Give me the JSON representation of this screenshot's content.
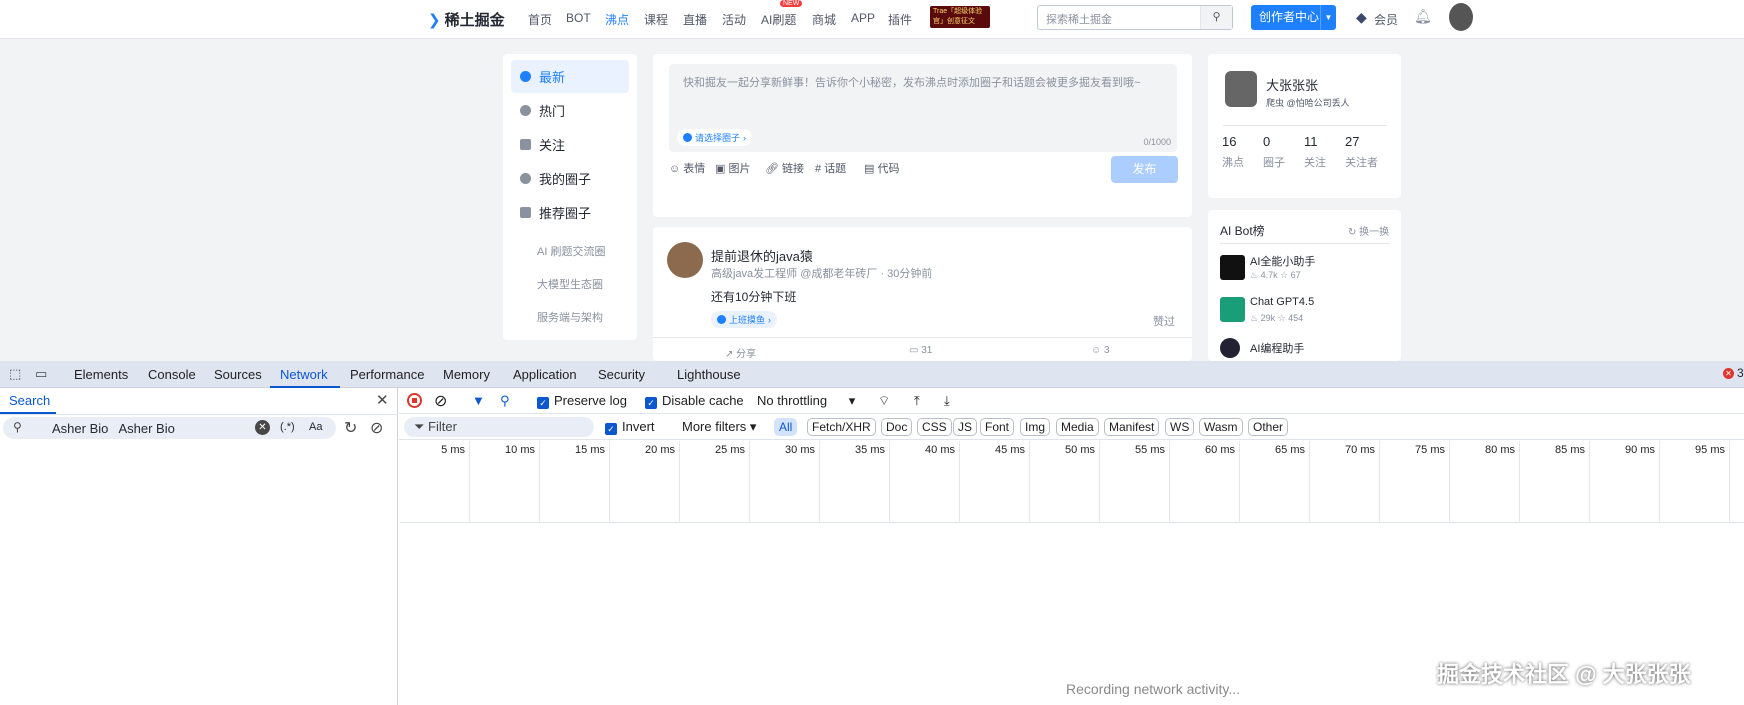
{
  "nav": {
    "logo": "稀土掘金",
    "items": [
      "首页",
      "BOT",
      "沸点",
      "课程",
      "直播",
      "活动",
      "AI刷题",
      "商城",
      "APP",
      "插件"
    ],
    "active": "沸点",
    "new_badge": "NEW",
    "promo": "Trae「超级体验官」创意征文",
    "search_placeholder": "探索稀土掘金",
    "creator": "创作者中心",
    "vip": "会员"
  },
  "sidebar": {
    "items": [
      "最新",
      "热门",
      "关注",
      "我的圈子",
      "推荐圈子"
    ],
    "active": "最新",
    "sub": [
      "AI 刷题交流圈",
      "大模型生态圈",
      "服务端与架构"
    ]
  },
  "composer": {
    "placeholder": "快和掘友一起分享新鲜事！告诉你个小秘密，发布沸点时添加圈子和话题会被更多掘友看到哦~",
    "circle": "请选择圈子",
    "count": "0/1000",
    "tools": [
      "表情",
      "图片",
      "链接",
      "话题",
      "代码"
    ],
    "publish": "发布"
  },
  "post": {
    "author": "提前退休的java猿",
    "meta": "高级java发工程师 @成都老年砖厂 · 30分钟前",
    "content": "还有10分钟下班",
    "tag": "上班摸鱼",
    "liked": "赞过",
    "actions": [
      "分享",
      "31",
      "3"
    ]
  },
  "profile": {
    "name": "大张张张",
    "desc": "爬虫 @怕哈公司丢人",
    "stats": [
      {
        "n": "16",
        "l": "沸点"
      },
      {
        "n": "0",
        "l": "圈子"
      },
      {
        "n": "11",
        "l": "关注"
      },
      {
        "n": "27",
        "l": "关注者"
      }
    ]
  },
  "bots": {
    "title": "AI Bot榜",
    "refresh": "换一换",
    "items": [
      {
        "name": "AI全能小助手",
        "hot": "4.7k",
        "star": "67"
      },
      {
        "name": "Chat GPT4.5",
        "hot": "29k",
        "star": "454"
      },
      {
        "name": "AI编程助手"
      }
    ]
  },
  "devtools": {
    "tabs": [
      "Elements",
      "Console",
      "Sources",
      "Network",
      "Performance",
      "Memory",
      "Application",
      "Security",
      "Lighthouse"
    ],
    "active_tab": "Network",
    "error_count": "3",
    "search": {
      "title": "Search",
      "query": "Asher Bio   Asher Bio",
      "regex": "(.*)",
      "case": "Aa"
    },
    "toolbar": {
      "preserve_log": "Preserve log",
      "disable_cache": "Disable cache",
      "throttling": "No throttling"
    },
    "filter": {
      "placeholder": "Filter",
      "invert": "Invert",
      "more": "More filters",
      "types": [
        "All",
        "Fetch/XHR",
        "Doc",
        "CSS",
        "JS",
        "Font",
        "Img",
        "Media",
        "Manifest",
        "WS",
        "Wasm",
        "Other"
      ]
    },
    "ticks": [
      "5 ms",
      "10 ms",
      "15 ms",
      "20 ms",
      "25 ms",
      "30 ms",
      "35 ms",
      "40 ms",
      "45 ms",
      "50 ms",
      "55 ms",
      "60 ms",
      "65 ms",
      "70 ms",
      "75 ms",
      "80 ms",
      "85 ms",
      "90 ms",
      "95 ms"
    ],
    "status": "Recording network activity..."
  },
  "watermark": "掘金技术社区 @ 大张张张"
}
